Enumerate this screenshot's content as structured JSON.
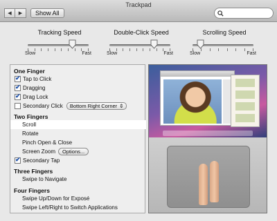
{
  "window": {
    "title": "Trackpad"
  },
  "toolbar": {
    "back_glyph": "◀",
    "forward_glyph": "▶",
    "show_all_label": "Show All",
    "search_value": ""
  },
  "sliders": [
    {
      "label": "Tracking Speed",
      "min_label": "Slow",
      "max_label": "Fast",
      "value_fraction": 0.73,
      "ticks": 10
    },
    {
      "label": "Double-Click Speed",
      "min_label": "Slow",
      "max_label": "Fast",
      "value_fraction": 0.73,
      "ticks": 10
    },
    {
      "label": "Scrolling Speed",
      "min_label": "Slow",
      "max_label": "Fast",
      "value_fraction": 0.13,
      "ticks": 8
    }
  ],
  "options": {
    "one_finger": {
      "header": "One Finger",
      "tap_to_click": {
        "label": "Tap to Click",
        "checked": true
      },
      "dragging": {
        "label": "Dragging",
        "checked": true
      },
      "drag_lock": {
        "label": "Drag Lock",
        "checked": true
      },
      "secondary_click": {
        "label": "Secondary Click",
        "checked": false,
        "popup_value": "Bottom Right Corner"
      }
    },
    "two_fingers": {
      "header": "Two Fingers",
      "scroll": "Scroll",
      "rotate": "Rotate",
      "pinch": "Pinch Open & Close",
      "screen_zoom": "Screen Zoom",
      "options_button": "Options...",
      "secondary_tap": {
        "label": "Secondary Tap",
        "checked": true
      }
    },
    "three_fingers": {
      "header": "Three Fingers",
      "swipe": "Swipe to Navigate"
    },
    "four_fingers": {
      "header": "Four Fingers",
      "expose": "Swipe Up/Down for Exposé",
      "switch_apps": "Swipe Left/Right to Switch Applications"
    }
  },
  "icons": {
    "search": "magnifier-icon",
    "popup_arrows": "⇕"
  }
}
